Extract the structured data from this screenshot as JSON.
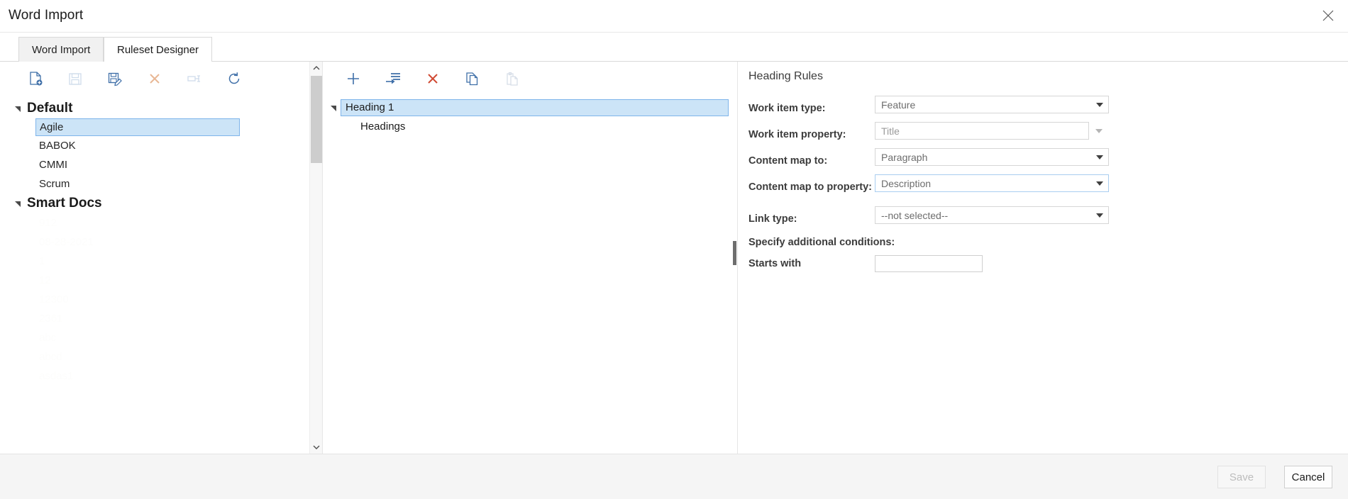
{
  "window": {
    "title": "Word Import",
    "close_icon": "close-icon"
  },
  "tabs": [
    {
      "label": "Word Import",
      "active": false
    },
    {
      "label": "Ruleset Designer",
      "active": true
    }
  ],
  "left_panel": {
    "toolbar": [
      {
        "name": "new-ruleset-icon",
        "label": "New ruleset",
        "enabled": true
      },
      {
        "name": "save-ruleset-icon",
        "label": "Save ruleset",
        "enabled": false
      },
      {
        "name": "save-as-ruleset-icon",
        "label": "Save ruleset as",
        "enabled": true
      },
      {
        "name": "delete-ruleset-icon",
        "label": "Delete ruleset",
        "enabled": true
      },
      {
        "name": "rename-ruleset-icon",
        "label": "Rename ruleset",
        "enabled": false
      },
      {
        "name": "refresh-icon",
        "label": "Refresh",
        "enabled": true
      }
    ],
    "groups": [
      {
        "label": "Default",
        "expanded": true,
        "items": [
          {
            "label": "Agile",
            "selected": true
          },
          {
            "label": "BABOK",
            "selected": false
          },
          {
            "label": "CMMI",
            "selected": false
          },
          {
            "label": "Scrum",
            "selected": false
          }
        ]
      },
      {
        "label": "Smart Docs",
        "expanded": true,
        "items": [
          {
            "label": "912",
            "selected": false
          },
          {
            "label": "08-28-2021",
            "selected": false
          },
          {
            "label": "1",
            "selected": false
          },
          {
            "label": "12",
            "selected": false
          },
          {
            "label": "12300",
            "selected": false
          },
          {
            "label": "2361",
            "selected": false
          },
          {
            "label": "abc",
            "selected": false
          },
          {
            "label": "abcd",
            "selected": false
          },
          {
            "label": "asdas1",
            "selected": false
          }
        ]
      }
    ],
    "scrollbar": {
      "up_icon": "chevron-up-icon",
      "down_icon": "chevron-down-icon"
    }
  },
  "mid_panel": {
    "toolbar": [
      {
        "name": "add-rule-icon",
        "label": "Add rule",
        "enabled": true
      },
      {
        "name": "add-child-rule-icon",
        "label": "Add child rule",
        "enabled": true
      },
      {
        "name": "delete-rule-icon",
        "label": "Delete rule",
        "enabled": true
      },
      {
        "name": "copy-rule-icon",
        "label": "Copy rule",
        "enabled": true
      },
      {
        "name": "paste-rule-icon",
        "label": "Paste rule",
        "enabled": false
      }
    ],
    "rules": [
      {
        "label": "Heading 1",
        "selected": true,
        "expanded": true,
        "level": 0
      },
      {
        "label": "Headings",
        "selected": false,
        "expanded": false,
        "level": 1
      }
    ]
  },
  "right_panel": {
    "section_title": "Heading Rules",
    "fields": [
      {
        "label": "Work item type:",
        "name": "work-item-type",
        "kind": "combo",
        "value": "Feature",
        "focused": false
      },
      {
        "label": "Work item property:",
        "name": "work-item-property",
        "kind": "combo-split",
        "value": "Title",
        "focused": false
      },
      {
        "label": "Content map to:",
        "name": "content-map-to",
        "kind": "combo",
        "value": "Paragraph",
        "focused": false
      },
      {
        "label": "Content map to property:",
        "name": "content-map-to-property",
        "kind": "combo",
        "value": "Description",
        "focused": true
      },
      {
        "label": "Link type:",
        "name": "link-type",
        "kind": "combo",
        "value": "--not selected--",
        "focused": false
      }
    ],
    "conditions_title": "Specify additional conditions:",
    "conditions": [
      {
        "label": "Starts with",
        "name": "starts-with",
        "value": "",
        "placeholder": ""
      }
    ]
  },
  "footer": {
    "save_label": "Save",
    "save_enabled": false,
    "cancel_label": "Cancel",
    "cancel_enabled": true
  },
  "colors": {
    "selection_fill": "#cce4f7",
    "selection_border": "#7eb4ea",
    "icon_blue": "#3f6fa8",
    "icon_red": "#d04a33",
    "icon_orange": "#e8b795",
    "disabled_text": "#bdbdbd"
  }
}
